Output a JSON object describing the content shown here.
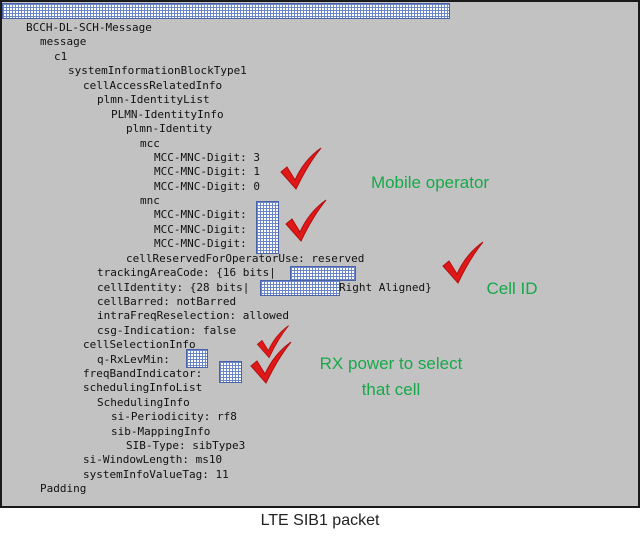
{
  "tree": {
    "bcch": "BCCH-DL-SCH-Message",
    "message": "message",
    "c1": "c1",
    "sib1": "systemInformationBlockType1",
    "cell_access": "cellAccessRelatedInfo",
    "plmn_list": "plmn-IdentityList",
    "plmn_info": "PLMN-IdentityInfo",
    "plmn_identity": "plmn-Identity",
    "mcc": "mcc",
    "mcc_digit_1": "MCC-MNC-Digit: 3",
    "mcc_digit_2": "MCC-MNC-Digit: 1",
    "mcc_digit_3": "MCC-MNC-Digit: 0",
    "mnc": "mnc",
    "mnc_digit_1": "MCC-MNC-Digit:",
    "mnc_digit_2": "MCC-MNC-Digit:",
    "mnc_digit_3": "MCC-MNC-Digit:",
    "cell_reserved": "cellReservedForOperatorUse: reserved",
    "tracking_area": "trackingAreaCode: {16 bits|",
    "cell_identity": "cellIdentity: {28 bits|",
    "cell_identity_suffix": "Right Aligned}",
    "cell_barred": "cellBarred: notBarred",
    "intra_freq": "intraFreqReselection: allowed",
    "csg": "csg-Indication: false",
    "cell_selection": "cellSelectionInfo",
    "q_rxlevmin": "q-RxLevMin:",
    "freq_band": "freqBandIndicator:",
    "scheduling_list": "schedulingInfoList",
    "scheduling_info": "SchedulingInfo",
    "si_periodicity": "si-Periodicity: rf8",
    "sib_mapping": "sib-MappingInfo",
    "sib_type": "SIB-Type: sibType3",
    "si_window": "si-WindowLength: ms10",
    "value_tag": "systemInfoValueTag: 11",
    "padding": "Padding"
  },
  "annotations": {
    "mobile_operator": "Mobile operator",
    "cell_id": "Cell ID",
    "rx_power_line1": "RX power to select",
    "rx_power_line2": "that cell"
  },
  "caption": "LTE SIB1 packet",
  "icons": {
    "check": "red-checkmark-icon",
    "redacted": "redacted-value-mask"
  },
  "colors": {
    "annotation_text": "#17a84a",
    "checkmark": "#e01818",
    "panel_bg": "#c2c2c2",
    "redaction_grid": "#6b86c8"
  }
}
